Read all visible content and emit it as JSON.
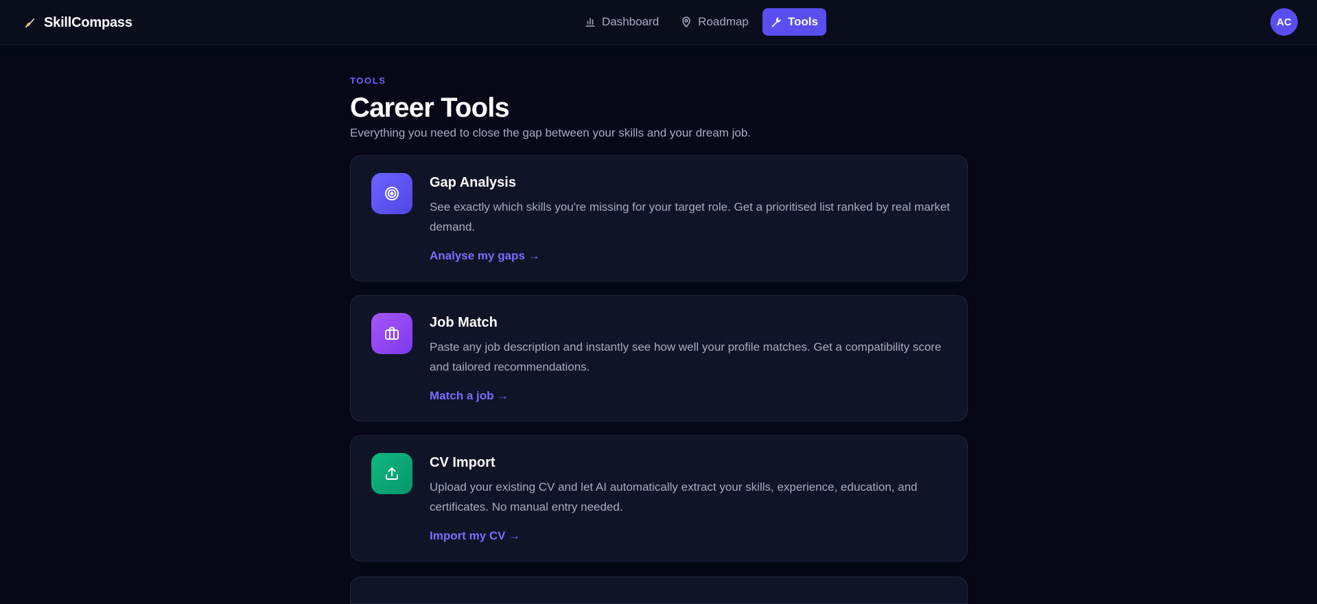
{
  "app": {
    "brand_name": "SkillCompass",
    "brand_icon": "rocket-icon"
  },
  "nav": {
    "items": [
      {
        "label": "Dashboard",
        "icon": "bar-chart-icon",
        "active": false
      },
      {
        "label": "Roadmap",
        "icon": "map-pin-icon",
        "active": false
      },
      {
        "label": "Tools",
        "icon": "wrench-icon",
        "active": true
      }
    ]
  },
  "user": {
    "initials": "AC"
  },
  "page": {
    "eyebrow": "TOOLS",
    "title": "Career Tools",
    "subtitle": "Everything you need to close the gap between your skills and your dream job."
  },
  "tools": [
    {
      "title": "Gap Analysis",
      "description": "See exactly which skills you're missing for your target role. Get a prioritised list ranked by real market demand.",
      "link": "Analyse my gaps →",
      "icon": "target-icon",
      "color_from": "#6d63ff",
      "color_to": "#4f46e5"
    },
    {
      "title": "Job Match",
      "description": "Paste any job description and instantly see how well your profile matches. Get a compatibility score and tailored recommendations.",
      "link": "Match a job →",
      "icon": "briefcase-icon",
      "color_from": "#a855f7",
      "color_to": "#7c3aed"
    },
    {
      "title": "CV Import",
      "description": "Upload your existing CV and let AI automatically extract your skills, experience, education, and certificates. No manual entry needed.",
      "link": "Import my CV →",
      "icon": "upload-icon",
      "color_from": "#10b981",
      "color_to": "#059669"
    }
  ],
  "colors": {
    "background": "#060818",
    "topbar": "#0a0d1c",
    "card": "#0f1527",
    "accent": "#5b4ef0",
    "link": "#7c6dff",
    "muted_text": "#a3acc0"
  }
}
